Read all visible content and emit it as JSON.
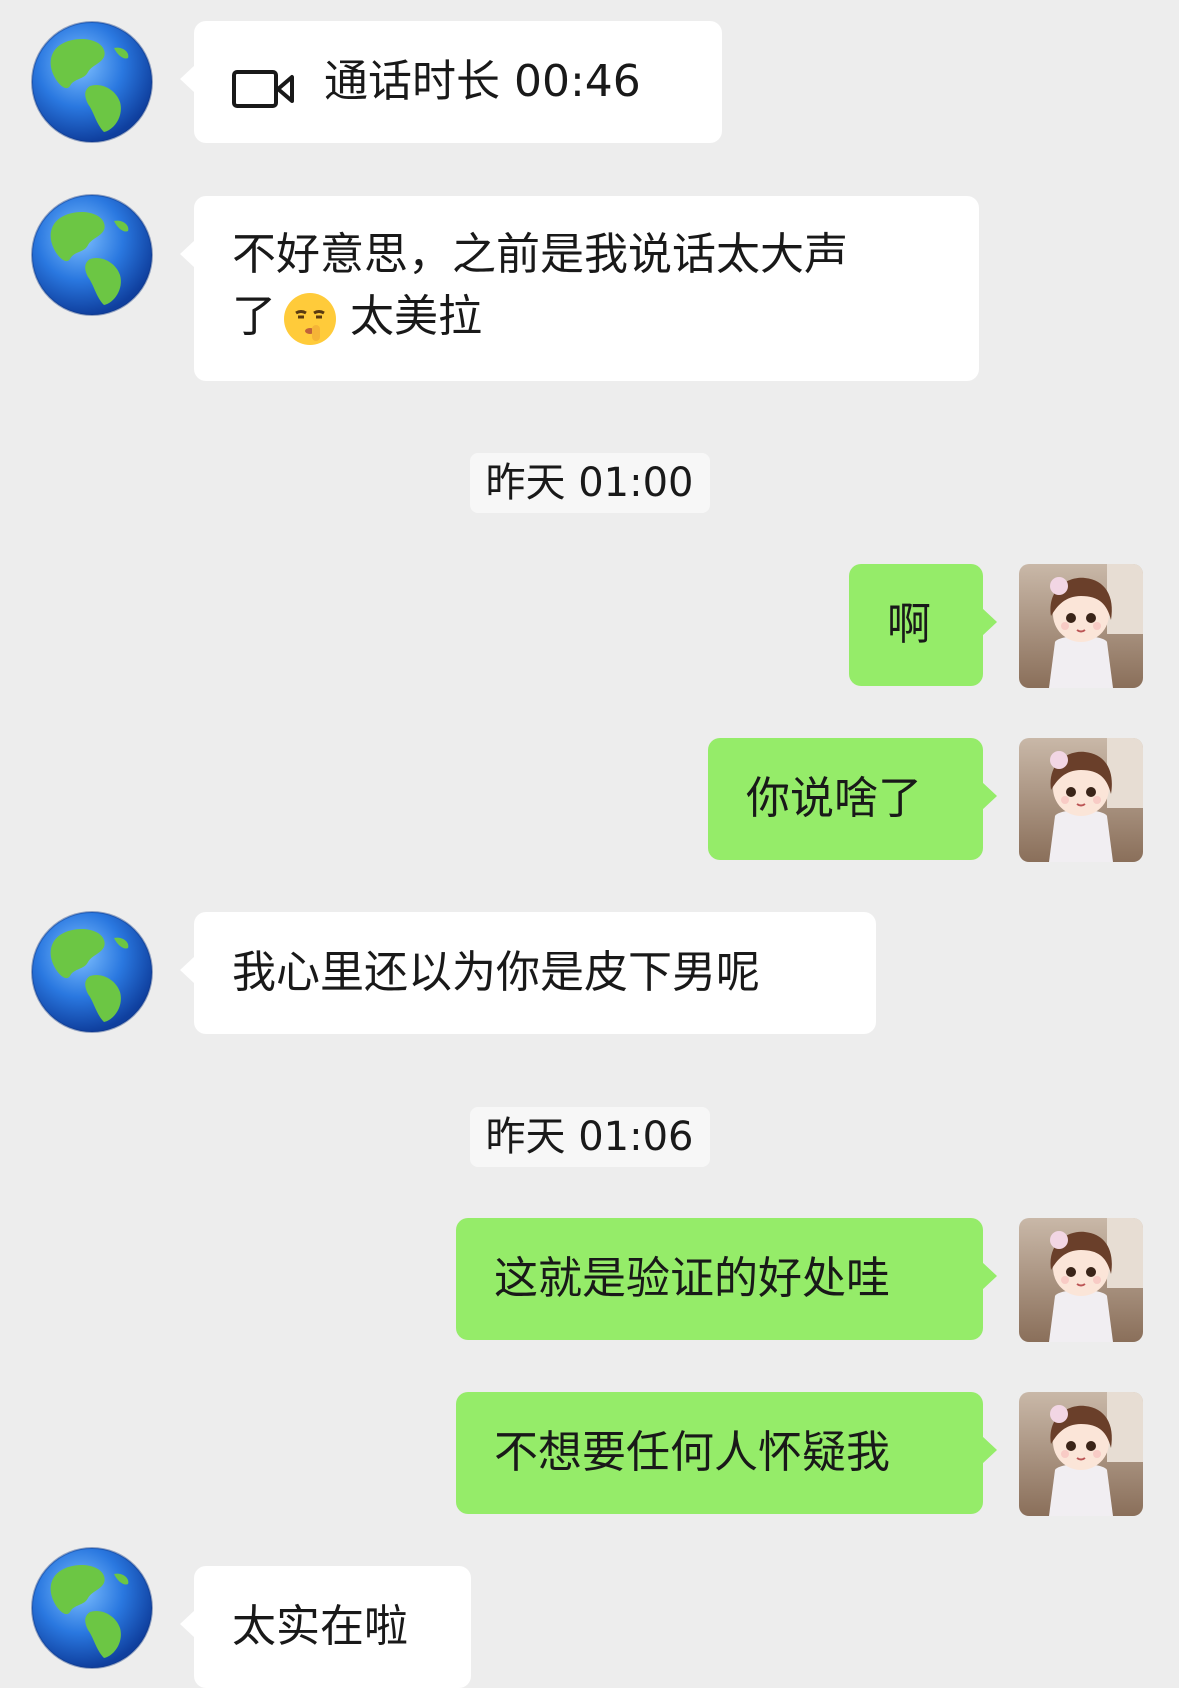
{
  "chat": {
    "messages": [
      {
        "side": "in",
        "type": "call",
        "icon": "video-camera-icon",
        "text": "通话时长 00:46"
      },
      {
        "side": "in",
        "line1": "不好意思，之前是我说话太大声",
        "line2_a": "了",
        "emoji": "shushing-face-emoji",
        "line2_b": "太美拉"
      },
      {
        "type": "timestamp",
        "text": "昨天 01:00"
      },
      {
        "side": "out",
        "text": "啊"
      },
      {
        "side": "out",
        "text": "你说啥了"
      },
      {
        "side": "in",
        "text": "我心里还以为你是皮下男呢"
      },
      {
        "type": "timestamp",
        "text": "昨天 01:06"
      },
      {
        "side": "out",
        "text": "这就是验证的好处哇"
      },
      {
        "side": "out",
        "text": "不想要任何人怀疑我"
      },
      {
        "side": "in",
        "text": "太实在啦"
      }
    ]
  },
  "colors": {
    "background": "#ededed",
    "incoming_bubble": "#ffffff",
    "outgoing_bubble": "#95ec69",
    "timestamp_bg": "#f7f7f7"
  },
  "avatars": {
    "contact": "globe-avatar",
    "self": "doll-girl-avatar"
  }
}
